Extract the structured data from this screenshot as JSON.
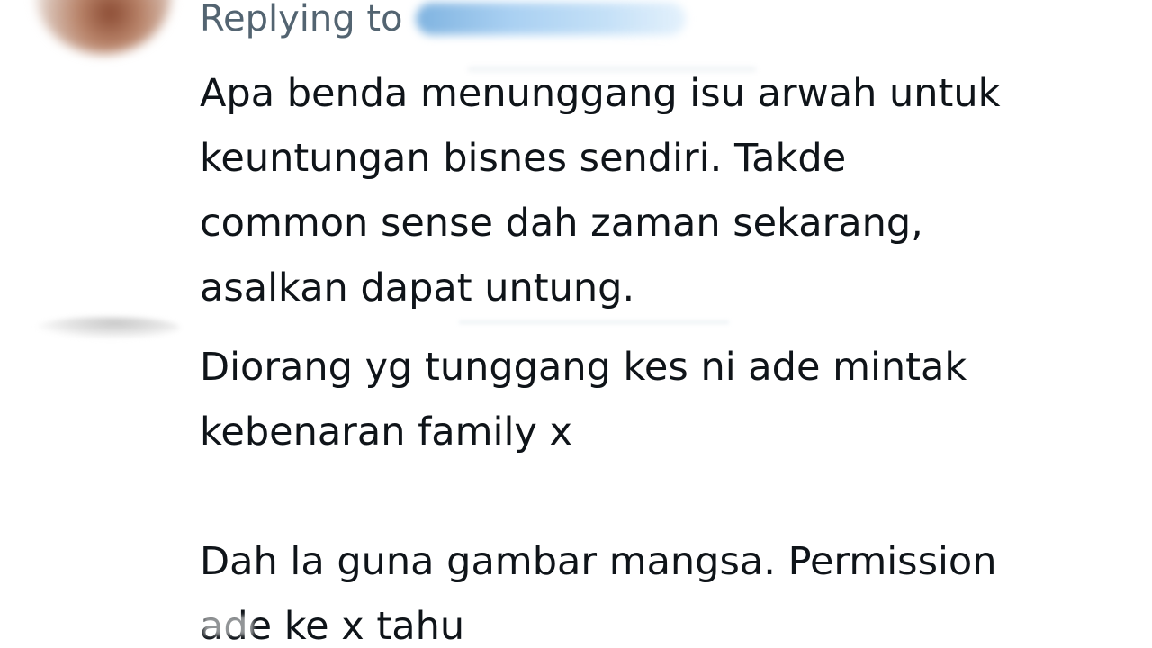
{
  "reply_header": {
    "prefix": "Replying to"
  },
  "tweets": [
    {
      "lines": [
        "Apa benda menunggang isu arwah untuk",
        "keuntungan bisnes sendiri. Takde",
        "common sense dah zaman sekarang,",
        "asalkan dapat untung."
      ]
    },
    {
      "lines": [
        "Diorang yg tunggang kes ni ade mintak",
        "kebenaran family x"
      ]
    },
    {
      "lines": [
        "Dah la guna gambar mangsa. Permission",
        "ade ke x tahu"
      ]
    }
  ],
  "colors": {
    "text_primary": "#0f1419",
    "text_secondary": "#536471",
    "handle_link": "#1d9bf0",
    "background": "#ffffff"
  }
}
